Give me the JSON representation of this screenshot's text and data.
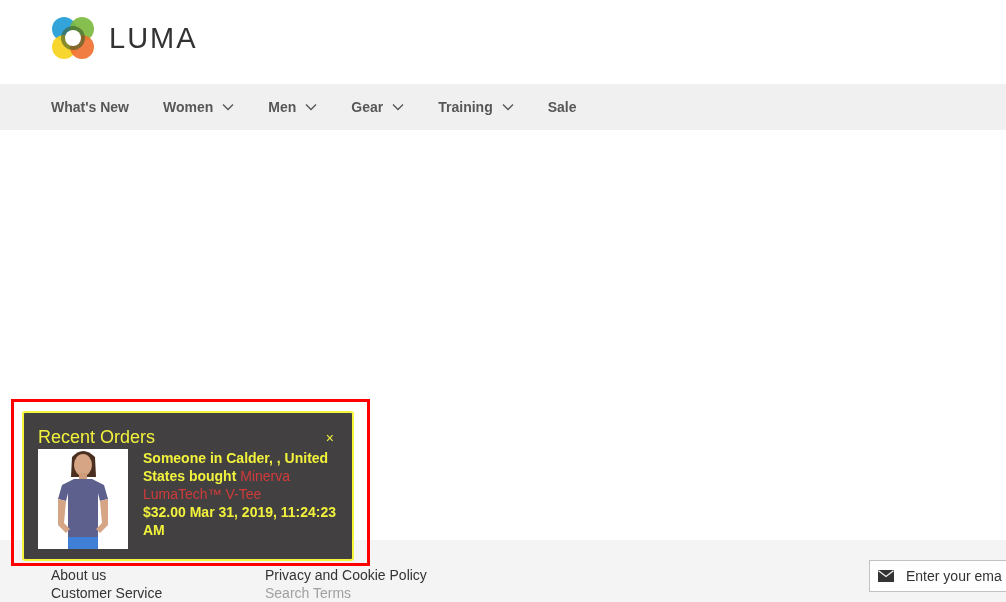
{
  "logo": {
    "text": "LUMA"
  },
  "nav": [
    {
      "label": "What's New",
      "dropdown": false
    },
    {
      "label": "Women",
      "dropdown": true
    },
    {
      "label": "Men",
      "dropdown": true
    },
    {
      "label": "Gear",
      "dropdown": true
    },
    {
      "label": "Training",
      "dropdown": true
    },
    {
      "label": "Sale",
      "dropdown": false
    }
  ],
  "footer": {
    "columns": [
      [
        {
          "label": "About us",
          "muted": false
        },
        {
          "label": "Customer Service",
          "muted": false
        }
      ],
      [
        {
          "label": "Privacy and Cookie Policy",
          "muted": false
        },
        {
          "label": "Search Terms",
          "muted": true
        }
      ]
    ],
    "newsletter": {
      "placeholder": "Enter your ema"
    }
  },
  "popup": {
    "title": "Recent Orders",
    "close": "×",
    "message": "Someone in Calder, , United States bought",
    "product": "Minerva LumaTech™ V-Tee",
    "details": "$32.00 Mar 31, 2019, 11:24:23 AM"
  },
  "annotation": {
    "kind": "frame"
  }
}
